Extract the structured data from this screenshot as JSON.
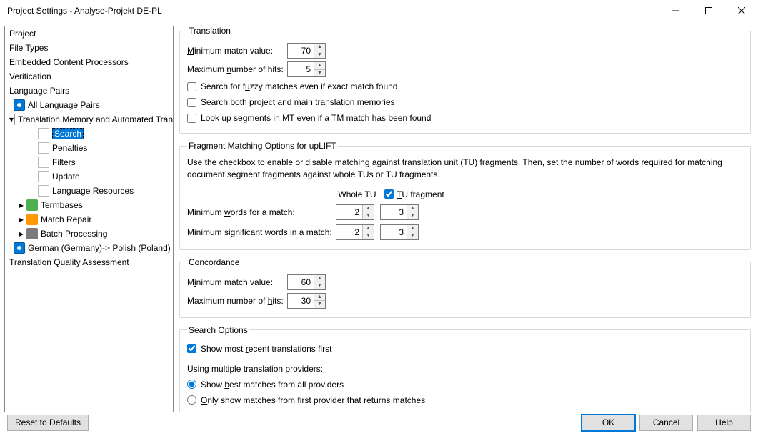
{
  "window": {
    "title": "Project Settings - Analyse-Projekt DE-PL"
  },
  "sidebar": {
    "project": "Project",
    "file_types": "File Types",
    "embedded": "Embedded Content Processors",
    "verification": "Verification",
    "lang_pairs": "Language Pairs",
    "all_pairs": "All Language Pairs",
    "tm_auto": "Translation Memory and Automated Translation",
    "search": "Search",
    "penalties": "Penalties",
    "filters": "Filters",
    "update": "Update",
    "lang_res": "Language Resources",
    "termbases": "Termbases",
    "match_repair": "Match Repair",
    "batch": "Batch Processing",
    "pair": "German (Germany)-> Polish (Poland)",
    "tqa": "Translation Quality Assessment"
  },
  "translation": {
    "legend": "Translation",
    "min_match": "Minimum match value:",
    "min_match_val": "70",
    "max_hits": "Maximum number of hits:",
    "max_hits_val": "5",
    "fuzzy": "Search for fuzzy matches even if exact match found",
    "both": "Search both project and main translation memories",
    "mt": "Look up segments in MT even if a TM match has been found"
  },
  "fragment": {
    "legend": "Fragment Matching Options for upLIFT",
    "desc": "Use the checkbox to enable or disable matching against translation unit (TU) fragments. Then, set the number of words required for matching document segment fragments against whole TUs or TU fragments.",
    "whole_tu": "Whole TU",
    "tu_fragment": "TU fragment",
    "min_words": "Minimum words for a match:",
    "min_words_whole": "2",
    "min_words_frag": "3",
    "min_sig": "Minimum significant words in a match:",
    "min_sig_whole": "2",
    "min_sig_frag": "3"
  },
  "concordance": {
    "legend": "Concordance",
    "min_match": "Minimum match value:",
    "min_match_val": "60",
    "max_hits": "Maximum number of hits:",
    "max_hits_val": "30"
  },
  "search_opts": {
    "legend": "Search Options",
    "recent": "Show most recent translations first",
    "using": "Using multiple translation providers:",
    "best": "Show best matches from all providers",
    "first": "Only show matches from first provider that returns matches"
  },
  "buttons": {
    "reset": "Reset to Defaults",
    "ok": "OK",
    "cancel": "Cancel",
    "help": "Help"
  }
}
